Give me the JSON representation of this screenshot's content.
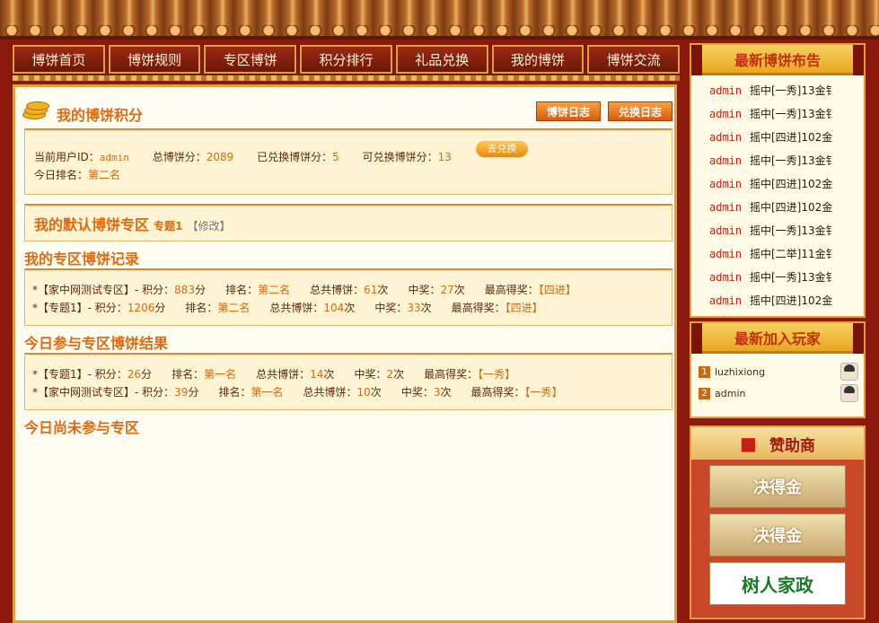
{
  "nav": [
    "博饼首页",
    "博饼规则",
    "专区博饼",
    "积分排行",
    "礼品兑换",
    "我的博饼",
    "博饼交流"
  ],
  "main": {
    "title": "我的博饼积分",
    "btn_log": "博饼日志",
    "btn_exchange": "兑换日志",
    "info": {
      "uid_label": "当前用户ID：",
      "uid": "admin",
      "total_label": "总博饼分：",
      "total": "2089",
      "exchanged_label": "已兑换博饼分：",
      "exchanged": "5",
      "available_label": "可兑换博饼分：",
      "available": "13",
      "exchange_btn": "去兑换",
      "rank_label": "今日排名：",
      "rank": "第二名"
    },
    "default_zone": {
      "title": "我的默认博饼专区",
      "zone": "专题1",
      "edit": "【修改】"
    },
    "records_title": "我的专区博饼记录",
    "records": [
      {
        "zone": "*【家中网测试专区】",
        "score_label": "- 积分：",
        "score": "883",
        "unit": "分",
        "rank_label": "排名：",
        "rank": "第二名",
        "total_label": "总共博饼：",
        "total": "61",
        "times": "次",
        "win_label": "中奖：",
        "win": "27",
        "best_label": "最高得奖：",
        "best": "【四进】"
      },
      {
        "zone": "*【专题1】",
        "score_label": "- 积分：",
        "score": "1206",
        "unit": "分",
        "rank_label": "排名：",
        "rank": "第二名",
        "total_label": "总共博饼：",
        "total": "104",
        "times": "次",
        "win_label": "中奖：",
        "win": "33",
        "best_label": "最高得奖：",
        "best": "【四进】"
      }
    ],
    "today_title": "今日参与专区博饼结果",
    "today": [
      {
        "zone": "*【专题1】",
        "score_label": "- 积分：",
        "score": "26",
        "unit": "分",
        "rank_label": "排名：",
        "rank": "第一名",
        "total_label": "总共博饼：",
        "total": "14",
        "times": "次",
        "win_label": "中奖：",
        "win": "2",
        "best_label": "最高得奖：",
        "best": "【一秀】"
      },
      {
        "zone": "*【家中网测试专区】",
        "score_label": "- 积分：",
        "score": "39",
        "unit": "分",
        "rank_label": "排名：",
        "rank": "第一名",
        "total_label": "总共博饼：",
        "total": "10",
        "times": "次",
        "win_label": "中奖：",
        "win": "3",
        "best_label": "最高得奖：",
        "best": "【一秀】"
      }
    ],
    "not_joined_title": "今日尚未参与专区"
  },
  "side": {
    "news_title": "最新博饼布告",
    "news": [
      {
        "user": "admin",
        "text": "摇中[一秀]13金钅"
      },
      {
        "user": "admin",
        "text": "摇中[一秀]13金钅"
      },
      {
        "user": "admin",
        "text": "摇中[四进]102金"
      },
      {
        "user": "admin",
        "text": "摇中[一秀]13金钅"
      },
      {
        "user": "admin",
        "text": "摇中[四进]102金"
      },
      {
        "user": "admin",
        "text": "摇中[四进]102金"
      },
      {
        "user": "admin",
        "text": "摇中[一秀]13金钅"
      },
      {
        "user": "admin",
        "text": "摇中[二举]11金钅"
      },
      {
        "user": "admin",
        "text": "摇中[一秀]13金钅"
      },
      {
        "user": "admin",
        "text": "摇中[四进]102金"
      }
    ],
    "players_title": "最新加入玩家",
    "players": [
      {
        "num": "1",
        "name": "luzhixiong"
      },
      {
        "num": "2",
        "name": "admin"
      }
    ],
    "sponsor_title": "赞助商",
    "sponsors": [
      "决得金",
      "决得金",
      "树人家政"
    ]
  }
}
